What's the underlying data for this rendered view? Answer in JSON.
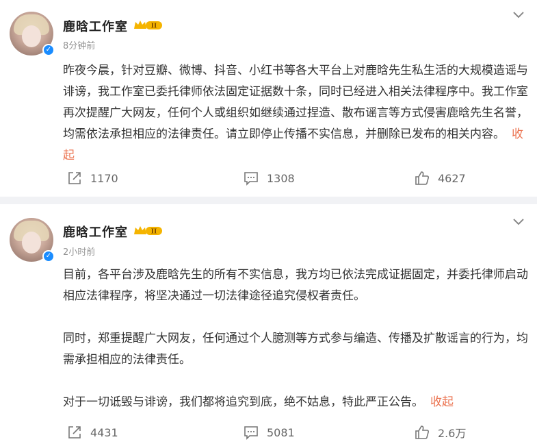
{
  "posts": [
    {
      "author": "鹿晗工作室",
      "time": "8分钟前",
      "paragraphs": [
        "昨夜今晨，针对豆瓣、微博、抖音、小红书等各大平台上对鹿晗先生私生活的大规模造谣与诽谤，我工作室已委托律师依法固定证据数十条，同时已经进入相关法律程序中。我工作室再次提醒广大网友，任何个人或组织如继续通过捏造、散布谣言等方式侵害鹿晗先生名誉，均需依法承担相应的法律责任。请立即停止传播不实信息，并删除已发布的相关内容。"
      ],
      "collapse_label": "收起",
      "badge_level": "II",
      "repost": "1170",
      "comment": "1308",
      "like": "4627"
    },
    {
      "author": "鹿晗工作室",
      "time": "2小时前",
      "paragraphs": [
        "目前，各平台涉及鹿晗先生的所有不实信息，我方均已依法完成证据固定，并委托律师启动相应法律程序，将坚决通过一切法律途径追究侵权者责任。",
        "同时，郑重提醒广大网友，任何通过个人臆测等方式参与编造、传播及扩散谣言的行为，均需承担相应的法律责任。",
        "对于一切诋毁与诽谤，我们都将追究到底，绝不姑息，特此严正公告。"
      ],
      "collapse_label": "收起",
      "badge_level": "II",
      "repost": "4431",
      "comment": "5081",
      "like": "2.6万"
    }
  ],
  "colors": {
    "accent": "#eb7350",
    "verified": "#1a8cff",
    "crown": "#f5b400",
    "muted": "#939393",
    "divider": "#f1f2f5"
  },
  "icons": {
    "repost": "repost-icon",
    "comment": "comment-icon",
    "like": "thumbs-up-icon",
    "menu": "chevron-down-icon",
    "verified": "verified-icon",
    "badge": "crown-badge-icon"
  }
}
